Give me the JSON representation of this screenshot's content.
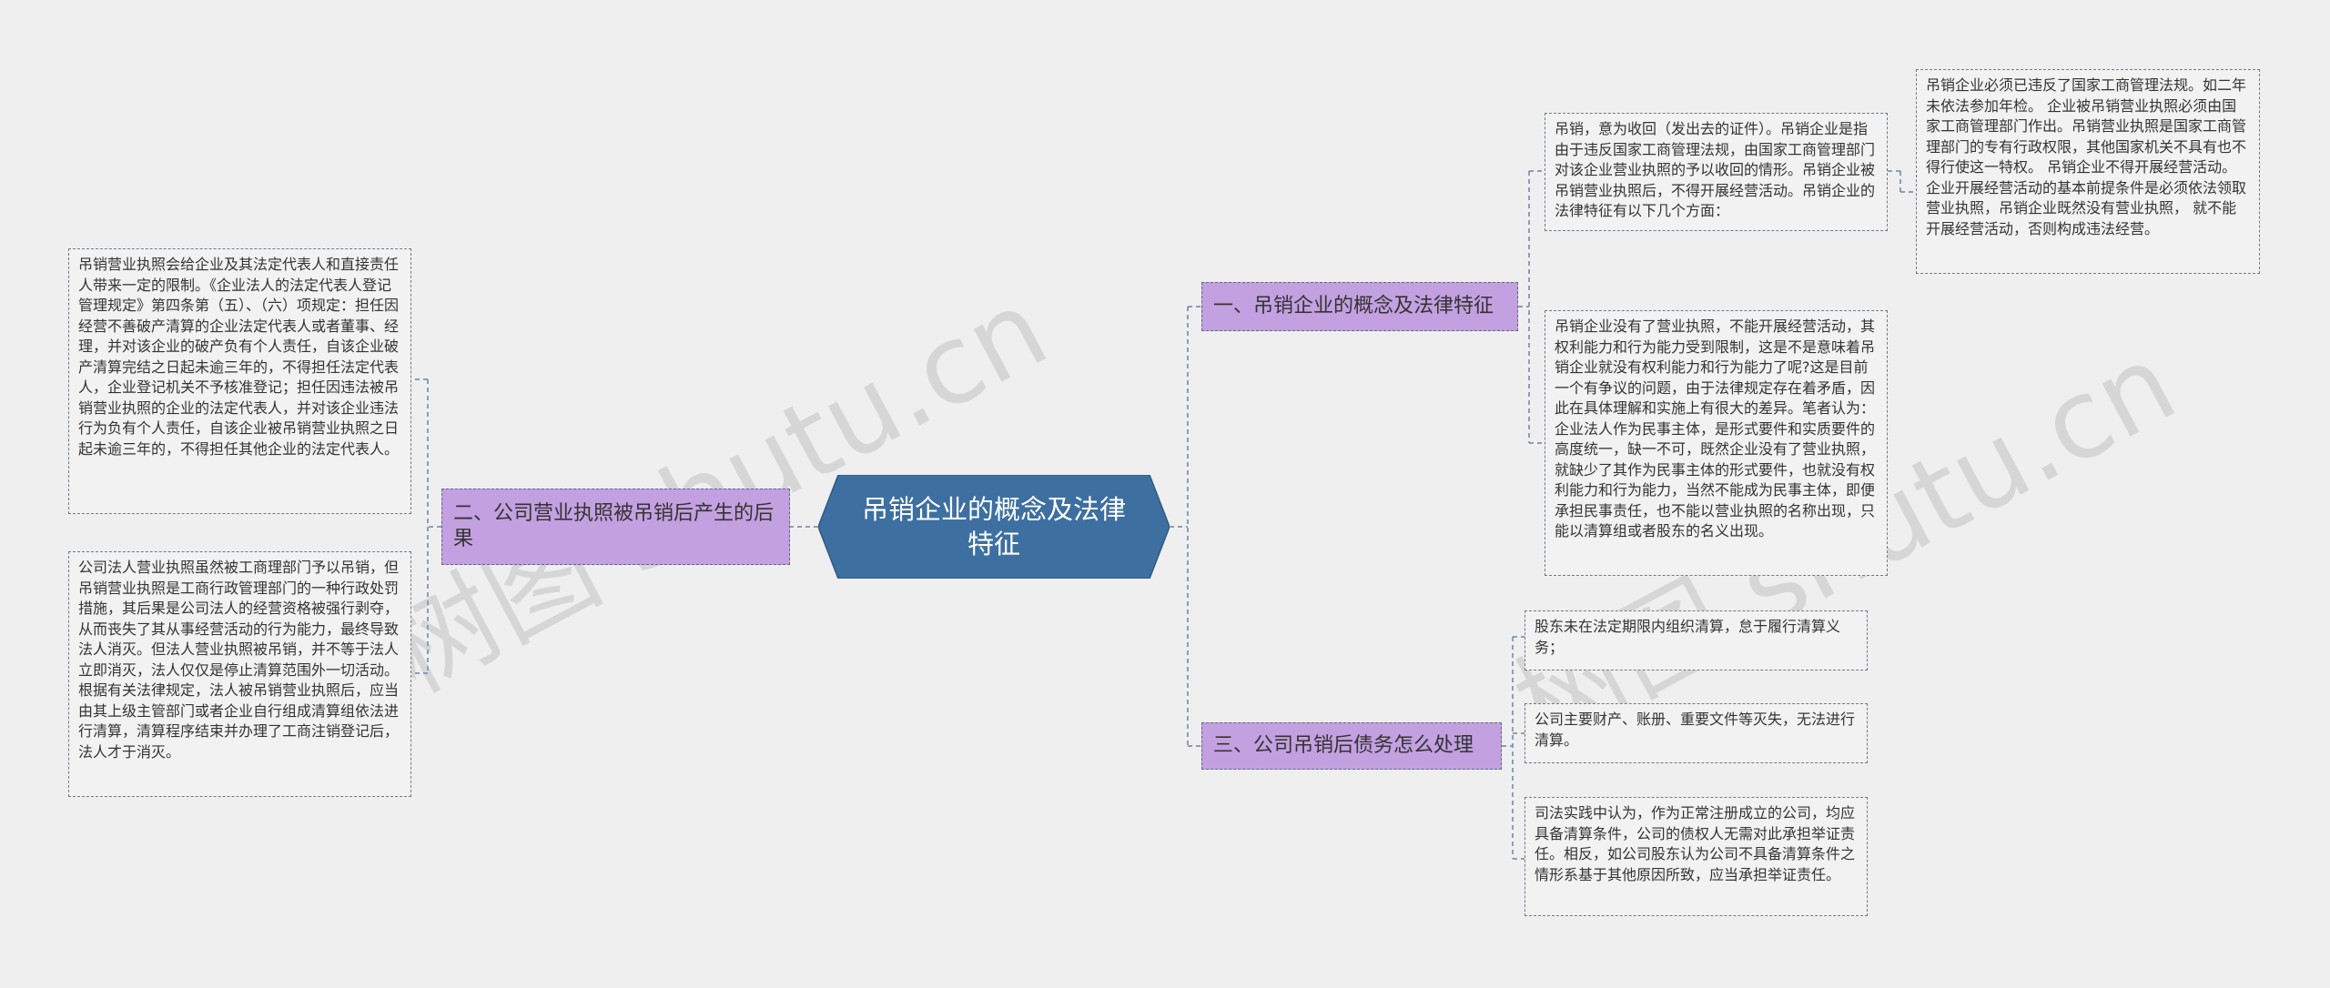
{
  "center": {
    "title": "吊销企业的概念及法律特征"
  },
  "branches": {
    "b1": {
      "label": "一、吊销企业的概念及法律特征"
    },
    "b2": {
      "label": "二、公司营业执照被吊销后产生的后果"
    },
    "b3": {
      "label": "三、公司吊销后债务怎么处理"
    }
  },
  "leaves": {
    "b1_1": "吊销，意为收回（发出去的证件）。吊销企业是指由于违反国家工商管理法规，由国家工商管理部门对该企业营业执照的予以收回的情形。吊销企业被吊销营业执照后，不得开展经营活动。吊销企业的法律特征有以下几个方面：",
    "b1_1_1": "吊销企业必须已违反了国家工商管理法规。如二年未依法参加年检。 企业被吊销营业执照必须由国家工商管理部门作出。吊销营业执照是国家工商管理部门的专有行政权限，其他国家机关不具有也不得行使这一特权。 吊销企业不得开展经营活动。企业开展经营活动的基本前提条件是必须依法领取营业执照，吊销企业既然没有营业执照， 就不能开展经营活动，否则构成违法经营。",
    "b1_2": "吊销企业没有了营业执照，不能开展经营活动，其权利能力和行为能力受到限制，这是不是意味着吊销企业就没有权利能力和行为能力了呢?这是目前一个有争议的问题，由于法律规定存在着矛盾，因此在具体理解和实施上有很大的差异。笔者认为：企业法人作为民事主体，是形式要件和实质要件的高度统一，缺一不可，既然企业没有了营业执照，就缺少了其作为民事主体的形式要件，也就没有权利能力和行为能力，当然不能成为民事主体，即便承担民事责任，也不能以营业执照的名称出现，只能以清算组或者股东的名义出现。",
    "b2_1": "吊销营业执照会给企业及其法定代表人和直接责任人带来一定的限制。《企业法人的法定代表人登记管理规定》第四条第（五）、（六）项规定：担任因经营不善破产清算的企业法定代表人或者董事、经理，并对该企业的破产负有个人责任，自该企业破产清算完结之日起未逾三年的，不得担任法定代表人，企业登记机关不予核准登记；担任因违法被吊销营业执照的企业的法定代表人，并对该企业违法行为负有个人责任，自该企业被吊销营业执照之日起未逾三年的，不得担任其他企业的法定代表人。",
    "b2_2": "公司法人营业执照虽然被工商理部门予以吊销，但吊销营业执照是工商行政管理部门的一种行政处罚措施，其后果是公司法人的经营资格被强行剥夺，从而丧失了其从事经营活动的行为能力，最终导致法人消灭。但法人营业执照被吊销，并不等于法人立即消灭，法人仅仅是停止清算范围外一切活动。根据有关法律规定，法人被吊销营业执照后，应当由其上级主管部门或者企业自行组成清算组依法进行清算，清算程序结束并办理了工商注销登记后，法人才于消灭。",
    "b3_1": "股东未在法定期限内组织清算，怠于履行清算义务；",
    "b3_2": "公司主要财产、账册、重要文件等灭失，无法进行清算。",
    "b3_3": "司法实践中认为，作为正常注册成立的公司，均应具备清算条件，公司的债权人无需对此承担举证责任。相反，如公司股东认为公司不具备清算条件之情形系基于其他原因所致，应当承担举证责任。"
  },
  "watermarks": [
    "树图 shutu.cn",
    "树图 shutu.cn"
  ],
  "colors": {
    "center_fill": "#3d6fa0",
    "branch_fill": "#c3a0e0",
    "line": "#5f7f9c",
    "background": "#efefef"
  }
}
